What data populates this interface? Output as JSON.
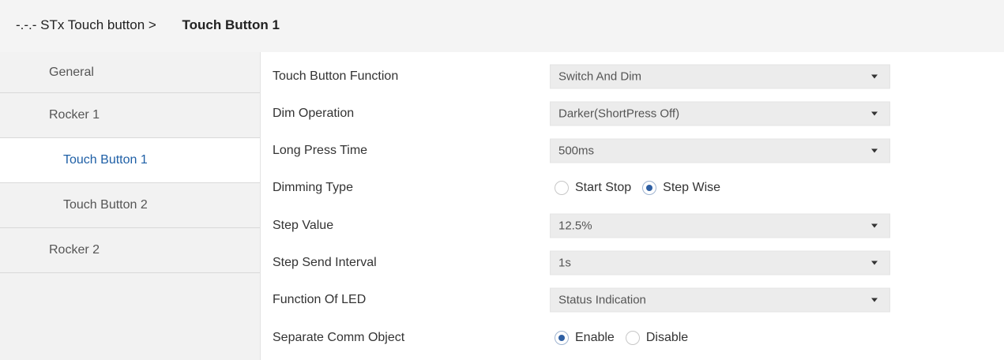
{
  "breadcrumb": {
    "parent": "-.-.- STx Touch button >",
    "current": "Touch Button 1"
  },
  "sidebar": {
    "items": [
      {
        "label": "General"
      },
      {
        "label": "Rocker 1"
      },
      {
        "label": "Touch Button 1"
      },
      {
        "label": "Touch Button 2"
      },
      {
        "label": "Rocker 2"
      }
    ],
    "active": "Touch Button 1"
  },
  "params": {
    "touch_button_function": {
      "label": "Touch Button Function",
      "value": "Switch And Dim"
    },
    "dim_operation": {
      "label": "Dim Operation",
      "value": "Darker(ShortPress Off)"
    },
    "long_press_time": {
      "label": "Long Press Time",
      "value": "500ms"
    },
    "dimming_type": {
      "label": "Dimming Type",
      "options": [
        "Start Stop",
        "Step Wise"
      ],
      "selected": "Step Wise"
    },
    "step_value": {
      "label": "Step Value",
      "value": "12.5%"
    },
    "step_send_interval": {
      "label": "Step Send Interval",
      "value": "1s"
    },
    "function_of_led": {
      "label": "Function Of LED",
      "value": "Status Indication"
    },
    "separate_comm_object": {
      "label": "Separate Comm Object",
      "options": [
        "Enable",
        "Disable"
      ],
      "selected": "Enable"
    }
  },
  "colors": {
    "accent": "#2e5fa3",
    "active_text": "#1e5fa6",
    "sidebar_bg": "#f2f2f2",
    "select_bg": "#ececec"
  },
  "icons": {
    "dropdown": "caret-down-icon",
    "radio": "radio-icon"
  }
}
